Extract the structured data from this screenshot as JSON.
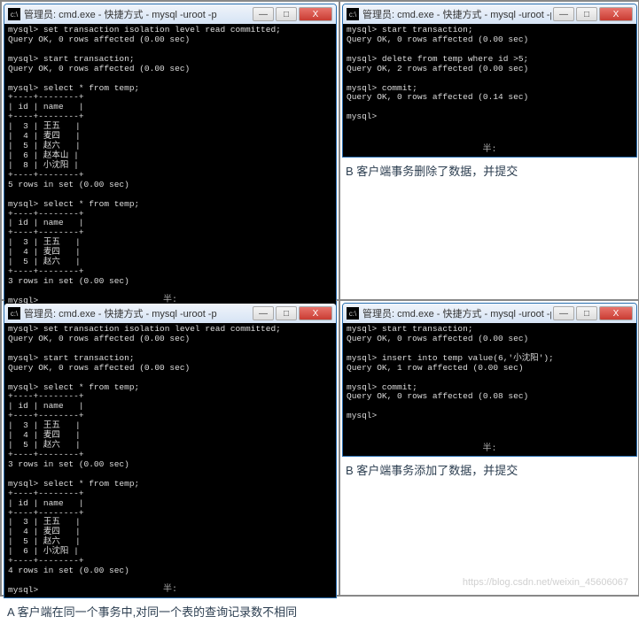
{
  "windowTitle": "管理员: cmd.exe - 快捷方式 - mysql  -uroot -p",
  "cells": {
    "a1": {
      "console": "mysql> set transaction isolation level read committed;\nQuery OK, 0 rows affected (0.00 sec)\n\nmysql> start transaction;\nQuery OK, 0 rows affected (0.00 sec)\n\nmysql> select * from temp;\n+----+--------+\n| id | name   |\n+----+--------+\n|  3 | 王五   |\n|  4 | 麦四   |\n|  5 | 赵六   |\n|  6 | 赵本山 |\n|  8 | 小沈阳 |\n+----+--------+\n5 rows in set (0.00 sec)\n\nmysql> select * from temp;\n+----+--------+\n| id | name   |\n+----+--------+\n|  3 | 王五   |\n|  4 | 麦四   |\n|  5 | 赵六   |\n+----+--------+\n3 rows in set (0.00 sec)\n\nmysql>",
      "scrollHint": "半:",
      "caption": "A 客户端在同一个事务中,对同一个表的查询记录数不相同"
    },
    "b1": {
      "console": "mysql> start transaction;\nQuery OK, 0 rows affected (0.00 sec)\n\nmysql> delete from temp where id >5;\nQuery OK, 2 rows affected (0.00 sec)\n\nmysql> commit;\nQuery OK, 0 rows affected (0.14 sec)\n\nmysql>",
      "scrollHint": "半:",
      "caption": "B 客户端事务删除了数据，并提交"
    },
    "a2": {
      "console": "mysql> set transaction isolation level read committed;\nQuery OK, 0 rows affected (0.00 sec)\n\nmysql> start transaction;\nQuery OK, 0 rows affected (0.00 sec)\n\nmysql> select * from temp;\n+----+--------+\n| id | name   |\n+----+--------+\n|  3 | 王五   |\n|  4 | 麦四   |\n|  5 | 赵六   |\n+----+--------+\n3 rows in set (0.00 sec)\n\nmysql> select * from temp;\n+----+--------+\n| id | name   |\n+----+--------+\n|  3 | 王五   |\n|  4 | 麦四   |\n|  5 | 赵六   |\n|  6 | 小沈阳 |\n+----+--------+\n4 rows in set (0.00 sec)\n\nmysql>",
      "scrollHint": "半:",
      "caption": "A 客户端在同一个事务中,对同一个表的查询记录数不相同"
    },
    "b2": {
      "console": "mysql> start transaction;\nQuery OK, 0 rows affected (0.00 sec)\n\nmysql> insert into temp value(6,'小沈阳');\nQuery OK, 1 row affected (0.00 sec)\n\nmysql> commit;\nQuery OK, 0 rows affected (0.08 sec)\n\nmysql>",
      "scrollHint": "半:",
      "caption": "B 客户端事务添加了数据，并提交"
    }
  },
  "buttons": {
    "min": "—",
    "max": "□",
    "close": "X"
  },
  "iconGlyph": "c:\\",
  "watermark": "https://blog.csdn.net/weixin_45606067"
}
